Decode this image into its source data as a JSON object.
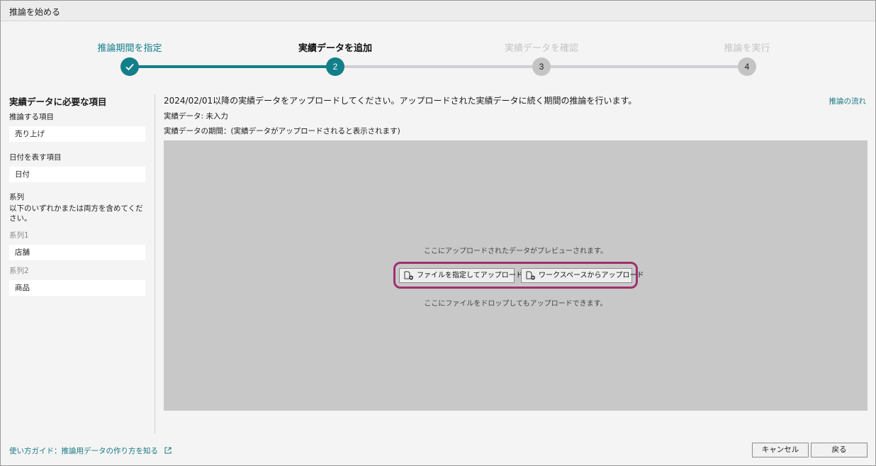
{
  "window": {
    "title": "推論を始める"
  },
  "stepper": {
    "steps": [
      {
        "label": "推論期間を指定",
        "number": "",
        "state": "done"
      },
      {
        "label": "実績データを追加",
        "number": "2",
        "state": "current"
      },
      {
        "label": "実績データを確認",
        "number": "3",
        "state": "pending"
      },
      {
        "label": "推論を実行",
        "number": "4",
        "state": "pending"
      }
    ]
  },
  "sidebar": {
    "title": "実績データに必要な項目",
    "target_label": "推論する項目",
    "target_value": "売り上げ",
    "date_label": "日付を表す項目",
    "date_value": "日付",
    "series_label": "系列",
    "series_note": "以下のいずれかまたは両方を含めてください。",
    "series1_label": "系列1",
    "series1_value": "店舗",
    "series2_label": "系列2",
    "series2_value": "商品"
  },
  "main": {
    "description": "2024/02/01以降の実績データをアップロードしてください。アップロードされた実績データに続く期間の推論を行います。",
    "flow_link": "推論の流れ",
    "status": "実績データ: 未入力",
    "period": "実績データの期間：(実績データがアップロードされると表示されます)",
    "preview_text": "ここにアップロードされたデータがプレビューされます。",
    "upload_file_button": "ファイルを指定してアップロード",
    "upload_workspace_button": "ワークスペースからアップロード",
    "drop_text": "ここにファイルをドロップしてもアップロードできます。"
  },
  "footer": {
    "guide_link": "使い方ガイド：推論用データの作り方を知る",
    "cancel_button": "キャンセル",
    "back_button": "戻る"
  },
  "colors": {
    "accent": "#127f89",
    "pending": "#c4c4c4",
    "highlight": "#a03070",
    "dropzone": "#c8c8c8"
  }
}
